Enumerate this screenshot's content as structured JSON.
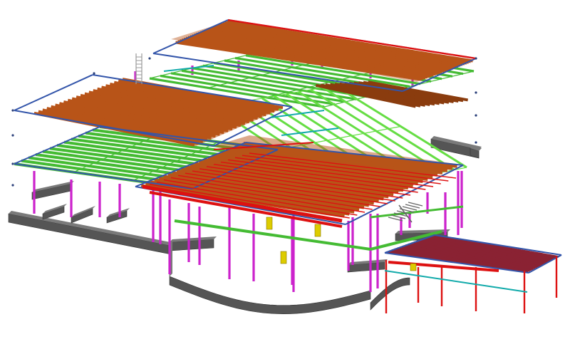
{
  "view": {
    "background": "#ffffff"
  },
  "palette": {
    "foundation": "#555555",
    "foundation_light": "#7a7a7a",
    "column": "#cc22cc",
    "beam_green": "#44bb33",
    "beam_green_light": "#66dd44",
    "rafter_orange": "#b85418",
    "rafter_orange_dark": "#8a3c0e",
    "deck_dark_red": "#8a2233",
    "edge_blue": "#3355aa",
    "red_member": "#dd1111",
    "cyan_member": "#11aaaa",
    "yellow_hanger": "#ddcc00"
  },
  "model": {
    "name": "",
    "levels": [
      "foundation",
      "floor",
      "roof"
    ]
  }
}
